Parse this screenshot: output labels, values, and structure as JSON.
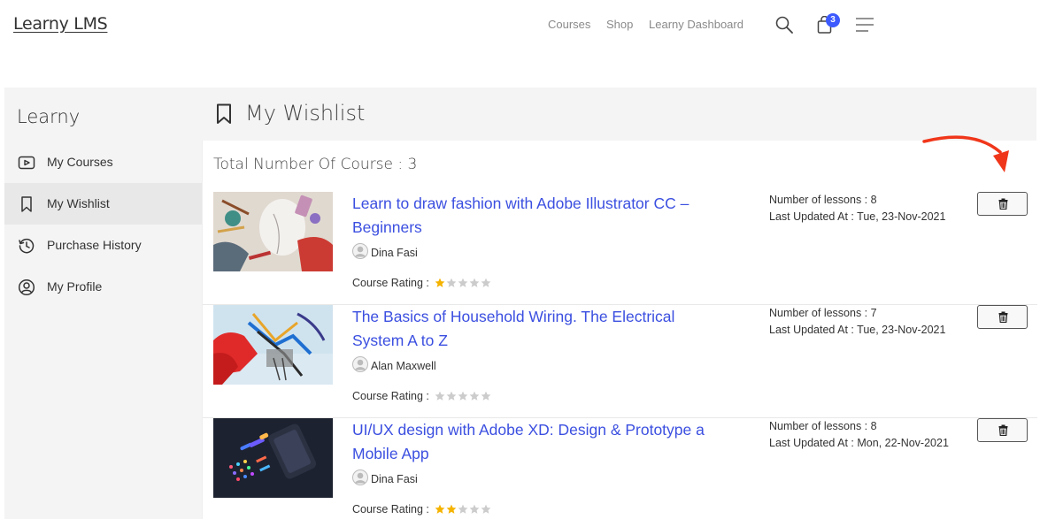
{
  "header": {
    "brand": "Learny LMS",
    "nav": [
      "Courses",
      "Shop",
      "Learny Dashboard"
    ],
    "cart_count": "3",
    "accent": "#3d5afe"
  },
  "sidebar": {
    "title": "Learny",
    "items": [
      {
        "label": "My Courses",
        "icon": "play-icon"
      },
      {
        "label": "My Wishlist",
        "icon": "bookmark-icon",
        "active": true
      },
      {
        "label": "Purchase History",
        "icon": "history-icon"
      },
      {
        "label": "My Profile",
        "icon": "user-icon"
      }
    ]
  },
  "main": {
    "title": "My Wishlist",
    "total": "Total Number Of Course : 3",
    "rating_label": "Course Rating :",
    "courses": [
      {
        "title": "Learn to draw fashion with Adobe Illustrator CC – Beginners",
        "author": "Dina Fasi",
        "rating": 1,
        "lessons": "Number of lessons : 8",
        "updated": "Last Updated At : Tue, 23-Nov-2021"
      },
      {
        "title": "The Basics of Household Wiring. The Electrical System A to Z",
        "author": "Alan Maxwell",
        "rating": 0,
        "lessons": "Number of lessons : 7",
        "updated": "Last Updated At : Tue, 23-Nov-2021"
      },
      {
        "title": "UI/UX design with Adobe XD: Design & Prototype a Mobile App",
        "author": "Dina Fasi",
        "rating": 2,
        "lessons": "Number of lessons : 8",
        "updated": "Last Updated At : Mon, 22-Nov-2021"
      }
    ]
  },
  "colors": {
    "link": "#3b4fe0",
    "star_filled": "#f5b301",
    "star_empty": "#cccccc",
    "annotation_arrow": "#f0361a"
  }
}
